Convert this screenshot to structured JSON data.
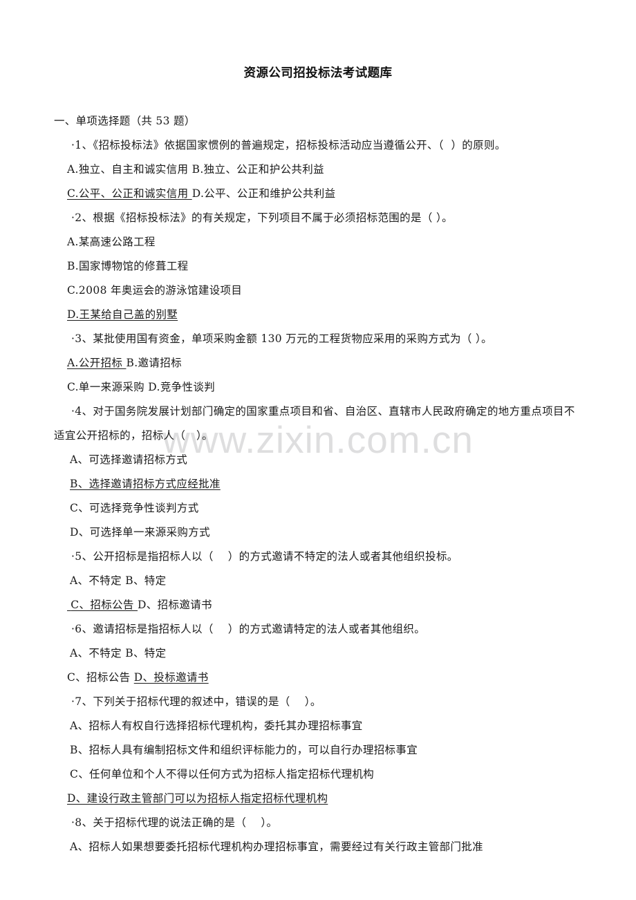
{
  "document": {
    "title": "资源公司招投标法考试题库",
    "watermark": "www.zixin.com.cn",
    "section_heading": "一、单项选择题（共 53 题）"
  },
  "questions": [
    {
      "stem": "·1、《招标投标法》依据国家惯例的普遍规定，招标投标活动应当遵循公开、（  ）的原则。",
      "option_lines": [
        {
          "plain": "A.独立、自主和诚实信用 B.独立、公正和护公共利益"
        },
        {
          "underlined": "C.公平、公正和诚实信用 ",
          "plain": "D.公平、公正和维护公共利益"
        }
      ]
    },
    {
      "stem": "·2、根据《招标投标法》的有关规定，下列项目不属于必须招标范围的是（ ）。",
      "option_lines": [
        {
          "plain": "A.某高速公路工程"
        },
        {
          "plain": "B.国家博物馆的修葺工程"
        },
        {
          "plain": "C.2008 年奥运会的游泳馆建设项目"
        },
        {
          "underlined": "D.王某给自己盖的别墅"
        }
      ]
    },
    {
      "stem": "·3、某批使用国有资金，单项采购金额 130 万元的工程货物应采用的采购方式为（ ）。",
      "option_lines": [
        {
          "underlined": "A.公开招标 ",
          "plain": "B.邀请招标"
        },
        {
          "plain": "C.单一来源采购 D.竞争性谈判"
        }
      ]
    },
    {
      "stem": "·4、对于国务院发展计划部门确定的国家重点项目和省、自治区、直辖市人民政府确定的地方重点项目不适宜公开招标的，招标人（   ）。",
      "wrap": true,
      "option_lines": [
        {
          "plain": "A、可选择邀请招标方式",
          "indent": true
        },
        {
          "underlined": "B、选择邀请招标方式应经批准",
          "indent": true
        },
        {
          "plain": "C、可选择竞争性谈判方式",
          "indent": true
        },
        {
          "plain": "D、可选择单一来源采购方式",
          "indent": true
        }
      ]
    },
    {
      "stem": "·5、公开招标是指招标人以（    ）的方式邀请不特定的法人或者其他组织投标。",
      "option_lines": [
        {
          "plain": "A、不特定 B、特定",
          "indent": true
        },
        {
          "underlined": " C、招标公告 ",
          "plain": "D、招标邀请书"
        }
      ]
    },
    {
      "stem": "·6、邀请招标是指招标人以（    ）的方式邀请特定的法人或者其他组织。",
      "option_lines": [
        {
          "plain": "A、不特定 B、特定",
          "indent": true
        },
        {
          "plain": "C、招标公告 ",
          "underlined": "D、投标邀请书"
        }
      ]
    },
    {
      "stem": "·7、下列关于招标代理的叙述中，错误的是（    ）。",
      "option_lines": [
        {
          "plain": "A、招标人有权自行选择招标代理机构，委托其办理招标事宜",
          "indent": true
        },
        {
          "plain": "B、招标人具有编制招标文件和组织评标能力的，可以自行办理招标事宜",
          "indent": true
        },
        {
          "plain": "C、任何单位和个人不得以任何方式为招标人指定招标代理机构",
          "indent": true
        },
        {
          "underlined": "D、建设行政主管部门可以为招标人指定招标代理机构"
        }
      ]
    },
    {
      "stem": "·8、关于招标代理的说法正确的是（    ）。",
      "option_lines": [
        {
          "plain": "A、招标人如果想要委托招标代理机构办理招标事宜，需要经过有关行政主管部门批准",
          "indent": true
        }
      ]
    }
  ]
}
